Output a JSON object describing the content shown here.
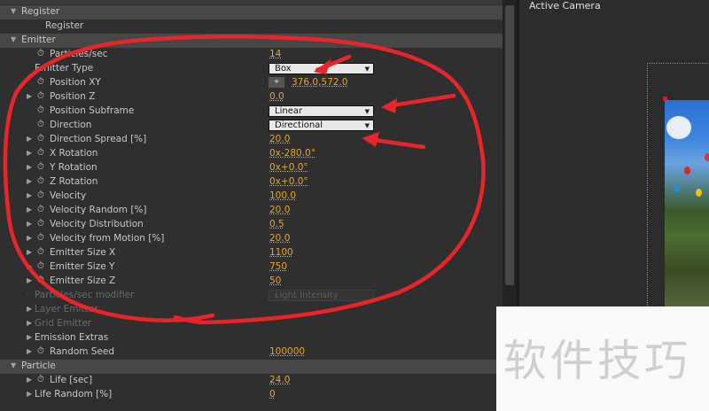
{
  "viewer": {
    "title": "Active Camera"
  },
  "watermark": "软件技巧",
  "colors": {
    "value": "#e9a52b",
    "annotation": "#e8252a",
    "panel": "#2f2f2f"
  },
  "rows": [
    {
      "type": "group",
      "label": "Register",
      "expanded": true
    },
    {
      "type": "param",
      "label": "Register",
      "indent": 51
    },
    {
      "type": "group",
      "label": "Emitter",
      "expanded": true
    },
    {
      "type": "param",
      "label": "Particles/sec",
      "sw": true,
      "value": "14"
    },
    {
      "type": "param",
      "label": "Emitter Type",
      "noSw": true,
      "dropdown": "Box"
    },
    {
      "type": "param",
      "label": "Position XY",
      "sw": true,
      "pointValue": "376.0,572.0"
    },
    {
      "type": "param",
      "label": "Position Z",
      "arrow": true,
      "sw": true,
      "value": "0.0"
    },
    {
      "type": "param",
      "label": "Position Subframe",
      "sw": true,
      "dropdown": "Linear"
    },
    {
      "type": "param",
      "label": "Direction",
      "sw": true,
      "dropdown": "Directional"
    },
    {
      "type": "param",
      "label": "Direction Spread [%]",
      "arrow": true,
      "sw": true,
      "value": "20.0"
    },
    {
      "type": "param",
      "label": "X Rotation",
      "arrow": true,
      "sw": true,
      "value": "0x-280.0°"
    },
    {
      "type": "param",
      "label": "Y Rotation",
      "arrow": true,
      "sw": true,
      "value": "0x+0.0°"
    },
    {
      "type": "param",
      "label": "Z Rotation",
      "arrow": true,
      "sw": true,
      "value": "0x+0.0°"
    },
    {
      "type": "param",
      "label": "Velocity",
      "arrow": true,
      "sw": true,
      "value": "100.0"
    },
    {
      "type": "param",
      "label": "Velocity Random [%]",
      "arrow": true,
      "sw": true,
      "value": "20.0"
    },
    {
      "type": "param",
      "label": "Velocity Distribution",
      "arrow": true,
      "sw": true,
      "value": "0.5"
    },
    {
      "type": "param",
      "label": "Velocity from Motion [%]",
      "arrow": true,
      "sw": true,
      "value": "20.0"
    },
    {
      "type": "param",
      "label": "Emitter Size X",
      "arrow": true,
      "sw": true,
      "value": "1100"
    },
    {
      "type": "param",
      "label": "Emitter Size Y",
      "arrow": true,
      "sw": true,
      "value": "750"
    },
    {
      "type": "param",
      "label": "Emitter Size Z",
      "arrow": true,
      "sw": true,
      "value": "50"
    },
    {
      "type": "param",
      "label": "Particles/sec modifier",
      "dim": true,
      "noSw": true,
      "dropdown": "Light Intensity",
      "disabled": true
    },
    {
      "type": "param",
      "label": "Layer Emitter",
      "dim": true,
      "arrow": true,
      "noSw": true
    },
    {
      "type": "param",
      "label": "Grid Emitter",
      "dim": true,
      "arrow": true,
      "noSw": true
    },
    {
      "type": "param",
      "label": "Emission Extras",
      "arrow": true,
      "noSw": true
    },
    {
      "type": "param",
      "label": "Random Seed",
      "arrow": true,
      "sw": true,
      "value": "100000"
    },
    {
      "type": "group",
      "label": "Particle",
      "expanded": true
    },
    {
      "type": "param",
      "label": "Life [sec]",
      "arrow": true,
      "sw": true,
      "value": "24.0"
    },
    {
      "type": "param",
      "label": "Life Random [%]",
      "arrow": true,
      "noSw": true,
      "value": "0"
    }
  ]
}
